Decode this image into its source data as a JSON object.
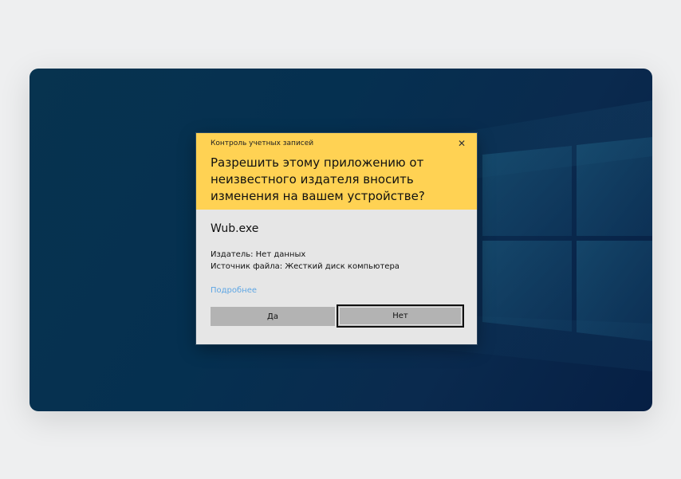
{
  "dialog": {
    "caption": "Контроль учетных записей",
    "question": "Разрешить этому приложению от неизвестного издателя вносить изменения на вашем устройстве?",
    "app_name": "Wub.exe",
    "publisher": "Издатель: Нет данных",
    "file_source": "Источник файла: Жесткий диск компьютера",
    "details_link": "Подробнее",
    "yes_label": "Да",
    "no_label": "Нет",
    "close_glyph": "✕"
  },
  "colors": {
    "header": "#ffd253",
    "body": "#e6e6e6",
    "button": "#b3b3b3",
    "link": "#5ea6e4",
    "desktop": "#053050"
  }
}
